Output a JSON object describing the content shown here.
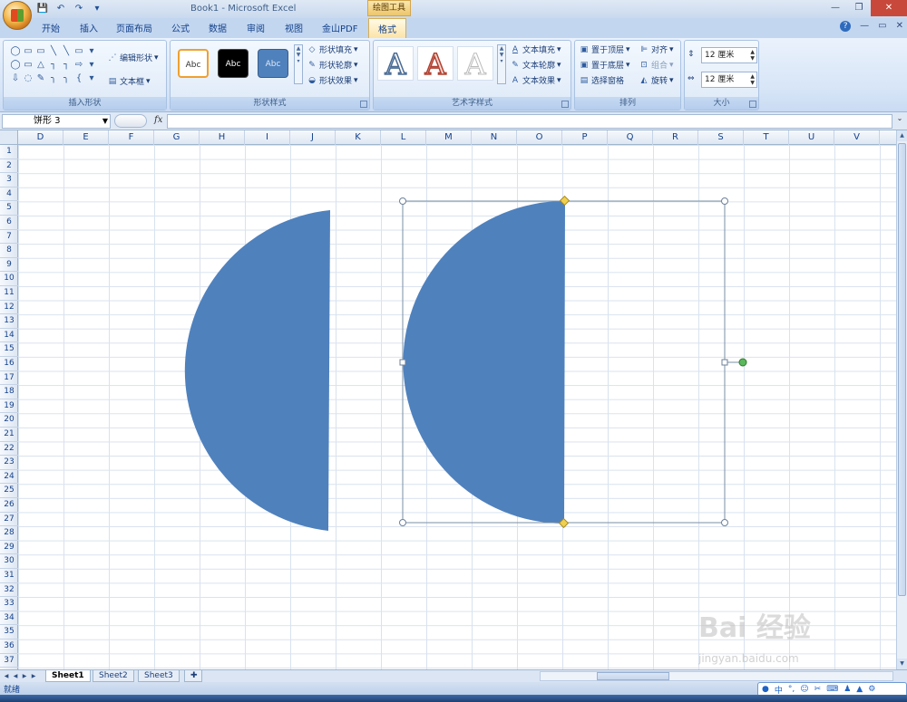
{
  "window": {
    "title": "Book1 - Microsoft Excel",
    "context_tool_label": "绘图工具"
  },
  "quick_access": {
    "save": "💾",
    "undo": "↶",
    "redo": "↷",
    "customize": "▾"
  },
  "tabs": [
    {
      "label": "开始"
    },
    {
      "label": "插入"
    },
    {
      "label": "页面布局"
    },
    {
      "label": "公式"
    },
    {
      "label": "数据"
    },
    {
      "label": "审阅"
    },
    {
      "label": "视图"
    },
    {
      "label": "金山PDF"
    },
    {
      "label": "格式"
    }
  ],
  "active_tab": "格式",
  "ribbon": {
    "insert_shapes": {
      "label": "插入形状",
      "edit_shape": "编辑形状",
      "text_box": "文本框",
      "glyphs": [
        "◯",
        "▭",
        "▭",
        "╲",
        "╲",
        "▭",
        "▾",
        "◯",
        "▭",
        "△",
        "┐",
        "┐",
        "⇨",
        "▾",
        "⇩",
        "◌",
        "✎",
        "╮",
        "╮",
        "{",
        "▾"
      ]
    },
    "shape_styles": {
      "label": "形状样式",
      "swatch_texts": [
        "Abc",
        "Abc",
        "Abc"
      ],
      "fill": "形状填充",
      "outline": "形状轮廓",
      "effects": "形状效果"
    },
    "wordart_styles": {
      "label": "艺术字样式",
      "samples": [
        "A",
        "A",
        "A"
      ],
      "text_fill": "文本填充",
      "text_outline": "文本轮廓",
      "text_effects": "文本效果"
    },
    "arrange": {
      "label": "排列",
      "bring_front": "置于顶层",
      "send_back": "置于底层",
      "selection_pane": "选择窗格",
      "align": "对齐",
      "group": "组合",
      "rotate": "旋转"
    },
    "size": {
      "label": "大小",
      "height": "12 厘米",
      "width": "12 厘米"
    }
  },
  "formula_bar": {
    "name_box": "饼形 3",
    "fx": "fx",
    "formula": ""
  },
  "columns": [
    "D",
    "E",
    "F",
    "G",
    "H",
    "I",
    "J",
    "K",
    "L",
    "M",
    "N",
    "O",
    "P",
    "Q",
    "R",
    "S",
    "T",
    "U",
    "V"
  ],
  "rows": [
    "1",
    "2",
    "3",
    "4",
    "5",
    "6",
    "7",
    "8",
    "9",
    "10",
    "11",
    "12",
    "13",
    "14",
    "15",
    "16",
    "17",
    "18",
    "19",
    "20",
    "21",
    "22",
    "23",
    "24",
    "25",
    "26",
    "27",
    "28",
    "29",
    "30",
    "31",
    "32",
    "33",
    "34",
    "35",
    "36",
    "37"
  ],
  "shapes": {
    "fill_color": "#4f81bd",
    "selection_color": "#7a8fa6",
    "rotation_handle_color": "#5cb85c",
    "adjust_handle_color": "#f0d050"
  },
  "sheets": [
    {
      "name": "Sheet1"
    },
    {
      "name": "Sheet2"
    },
    {
      "name": "Sheet3"
    }
  ],
  "active_sheet": "Sheet1",
  "status": {
    "text": "就绪"
  },
  "ime": {
    "label": "中"
  },
  "watermark": {
    "main": "Bai 经验",
    "sub": "jingyan.baidu.com"
  }
}
